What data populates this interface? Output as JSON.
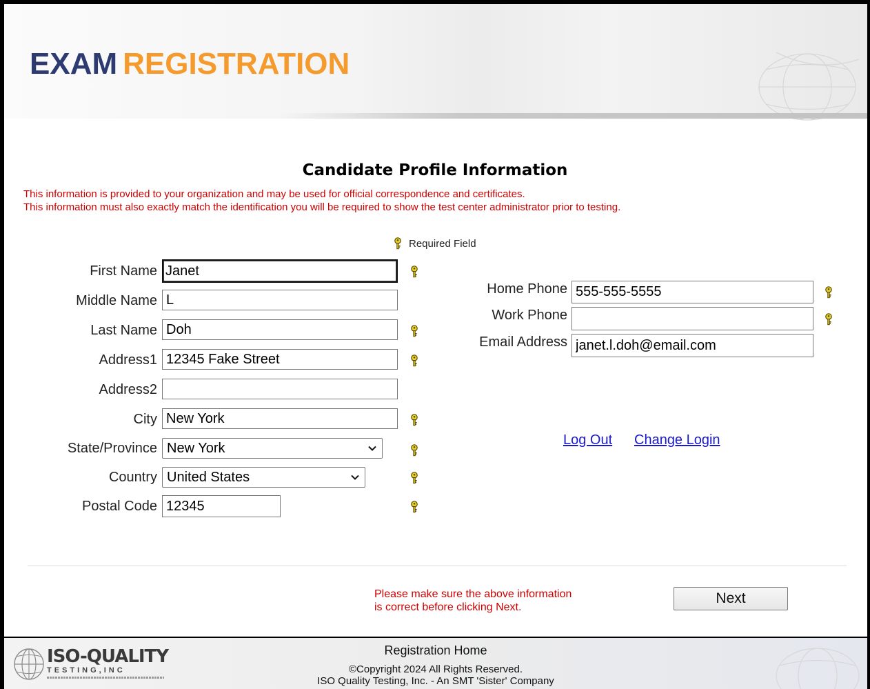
{
  "header": {
    "title_part1": "EXAM",
    "title_part2": "REGISTRATION",
    "colors": {
      "exam": "#2e3b70",
      "registration": "#f59a2c"
    }
  },
  "profile": {
    "heading": "Candidate Profile Information",
    "notice_line1": "This information is provided to your organization and may be used for official correspondence and certificates.",
    "notice_line2": "This information must also exactly match the identification you will be required to show the test center administrator prior to testing.",
    "required_legend": "Required Field",
    "required_icon": "key-icon"
  },
  "form": {
    "first_name": {
      "label": "First Name",
      "value": "Janet",
      "required": true
    },
    "middle_name": {
      "label": "Middle Name",
      "value": "L",
      "required": false
    },
    "last_name": {
      "label": "Last Name",
      "value": "Doh",
      "required": true
    },
    "address1": {
      "label": "Address1",
      "value": "12345 Fake Street",
      "required": true
    },
    "address2": {
      "label": "Address2",
      "value": "",
      "required": false
    },
    "city": {
      "label": "City",
      "value": "New York",
      "required": true
    },
    "state": {
      "label": "State/Province",
      "value": "New York",
      "required": true
    },
    "country": {
      "label": "Country",
      "value": "United States",
      "required": true
    },
    "postal_code": {
      "label": "Postal Code",
      "value": "12345",
      "required": true
    },
    "home_phone": {
      "label": "Home Phone",
      "value": "555-555-5555",
      "required": true
    },
    "work_phone": {
      "label": "Work Phone",
      "value": "",
      "required": true
    },
    "email": {
      "label": "Email Address",
      "value": "janet.l.doh@email.com",
      "required": false
    }
  },
  "links": {
    "logout": "Log Out",
    "change_login": "Change Login"
  },
  "actions": {
    "confirm_notice_line1": "Please make sure the above information",
    "confirm_notice_line2": "is correct before clicking Next.",
    "next_label": "Next"
  },
  "footer": {
    "home_link": "Registration Home",
    "copyright": "©Copyright 2024 All Rights Reserved.",
    "company": "ISO Quality Testing, Inc. - An SMT 'Sister' Company",
    "logo_main": "ISO-QUALITY",
    "logo_sub": "TESTING,INC"
  },
  "theme": {
    "notice_red": "#cc0000",
    "link_blue": "#1a1acc",
    "key_yellow": "#e8d32a"
  }
}
